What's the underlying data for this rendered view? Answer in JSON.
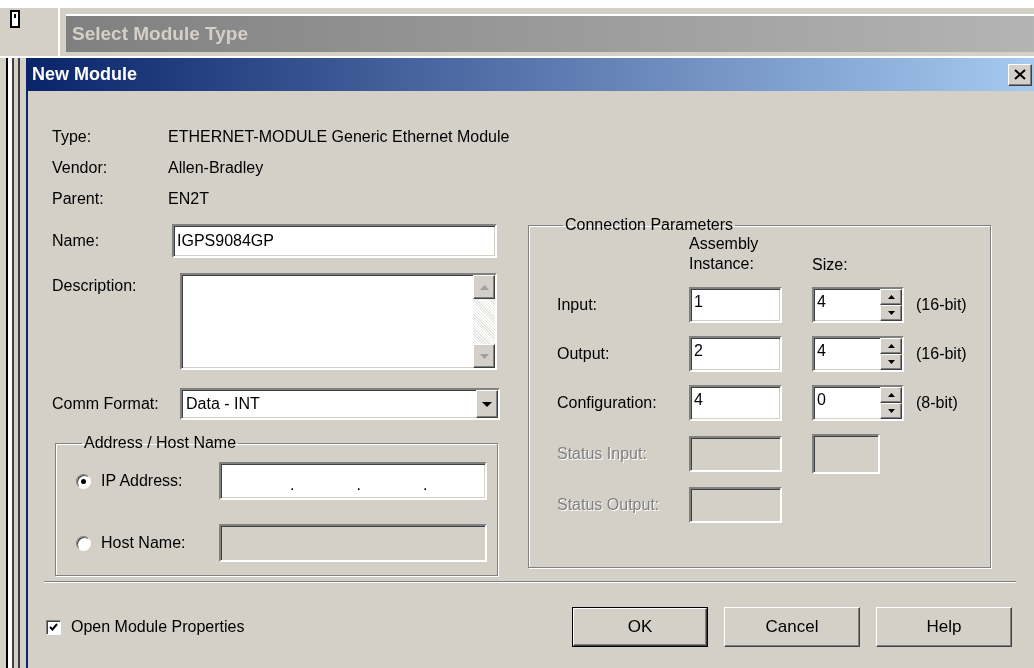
{
  "background_window": {
    "title": "Select Module Type"
  },
  "dialog": {
    "title": "New Module"
  },
  "info": [
    {
      "label": "Type:",
      "value": "ETHERNET-MODULE Generic Ethernet Module"
    },
    {
      "label": "Vendor:",
      "value": "Allen-Bradley"
    },
    {
      "label": "Parent:",
      "value": "EN2T"
    }
  ],
  "name": {
    "label": "Name:",
    "value": "IGPS9084GP"
  },
  "description": {
    "label": "Description:"
  },
  "comm_format": {
    "label": "Comm Format:",
    "value": "Data - INT"
  },
  "address": {
    "title": "Address / Host Name",
    "options": [
      {
        "label": "IP Address:",
        "selected": true,
        "kind": "ip",
        "separators": [
          ".",
          ".",
          "."
        ]
      },
      {
        "label": "Host Name:",
        "selected": false,
        "kind": "text"
      }
    ]
  },
  "connection": {
    "title": "Connection Parameters",
    "columns": [
      "Assembly Instance:",
      "Size:"
    ],
    "rows": [
      {
        "label": "Input:",
        "kind": "spinner",
        "instance": "1",
        "size": "4",
        "unit": "(16-bit)",
        "disabled": false
      },
      {
        "label": "Output:",
        "kind": "spinner",
        "instance": "2",
        "size": "4",
        "unit": "(16-bit)",
        "disabled": false
      },
      {
        "label": "Configuration:",
        "kind": "spinner",
        "instance": "4",
        "size": "0",
        "unit": "(8-bit)",
        "disabled": false
      },
      {
        "label": "Status Input:",
        "kind": "pair",
        "disabled": true
      },
      {
        "label": "Status Output:",
        "kind": "single",
        "disabled": true
      }
    ]
  },
  "open_properties": {
    "label": "Open Module Properties",
    "checked": true
  },
  "buttons": [
    {
      "label": "OK",
      "default": true
    },
    {
      "label": "Cancel",
      "default": false
    },
    {
      "label": "Help",
      "default": false
    }
  ]
}
